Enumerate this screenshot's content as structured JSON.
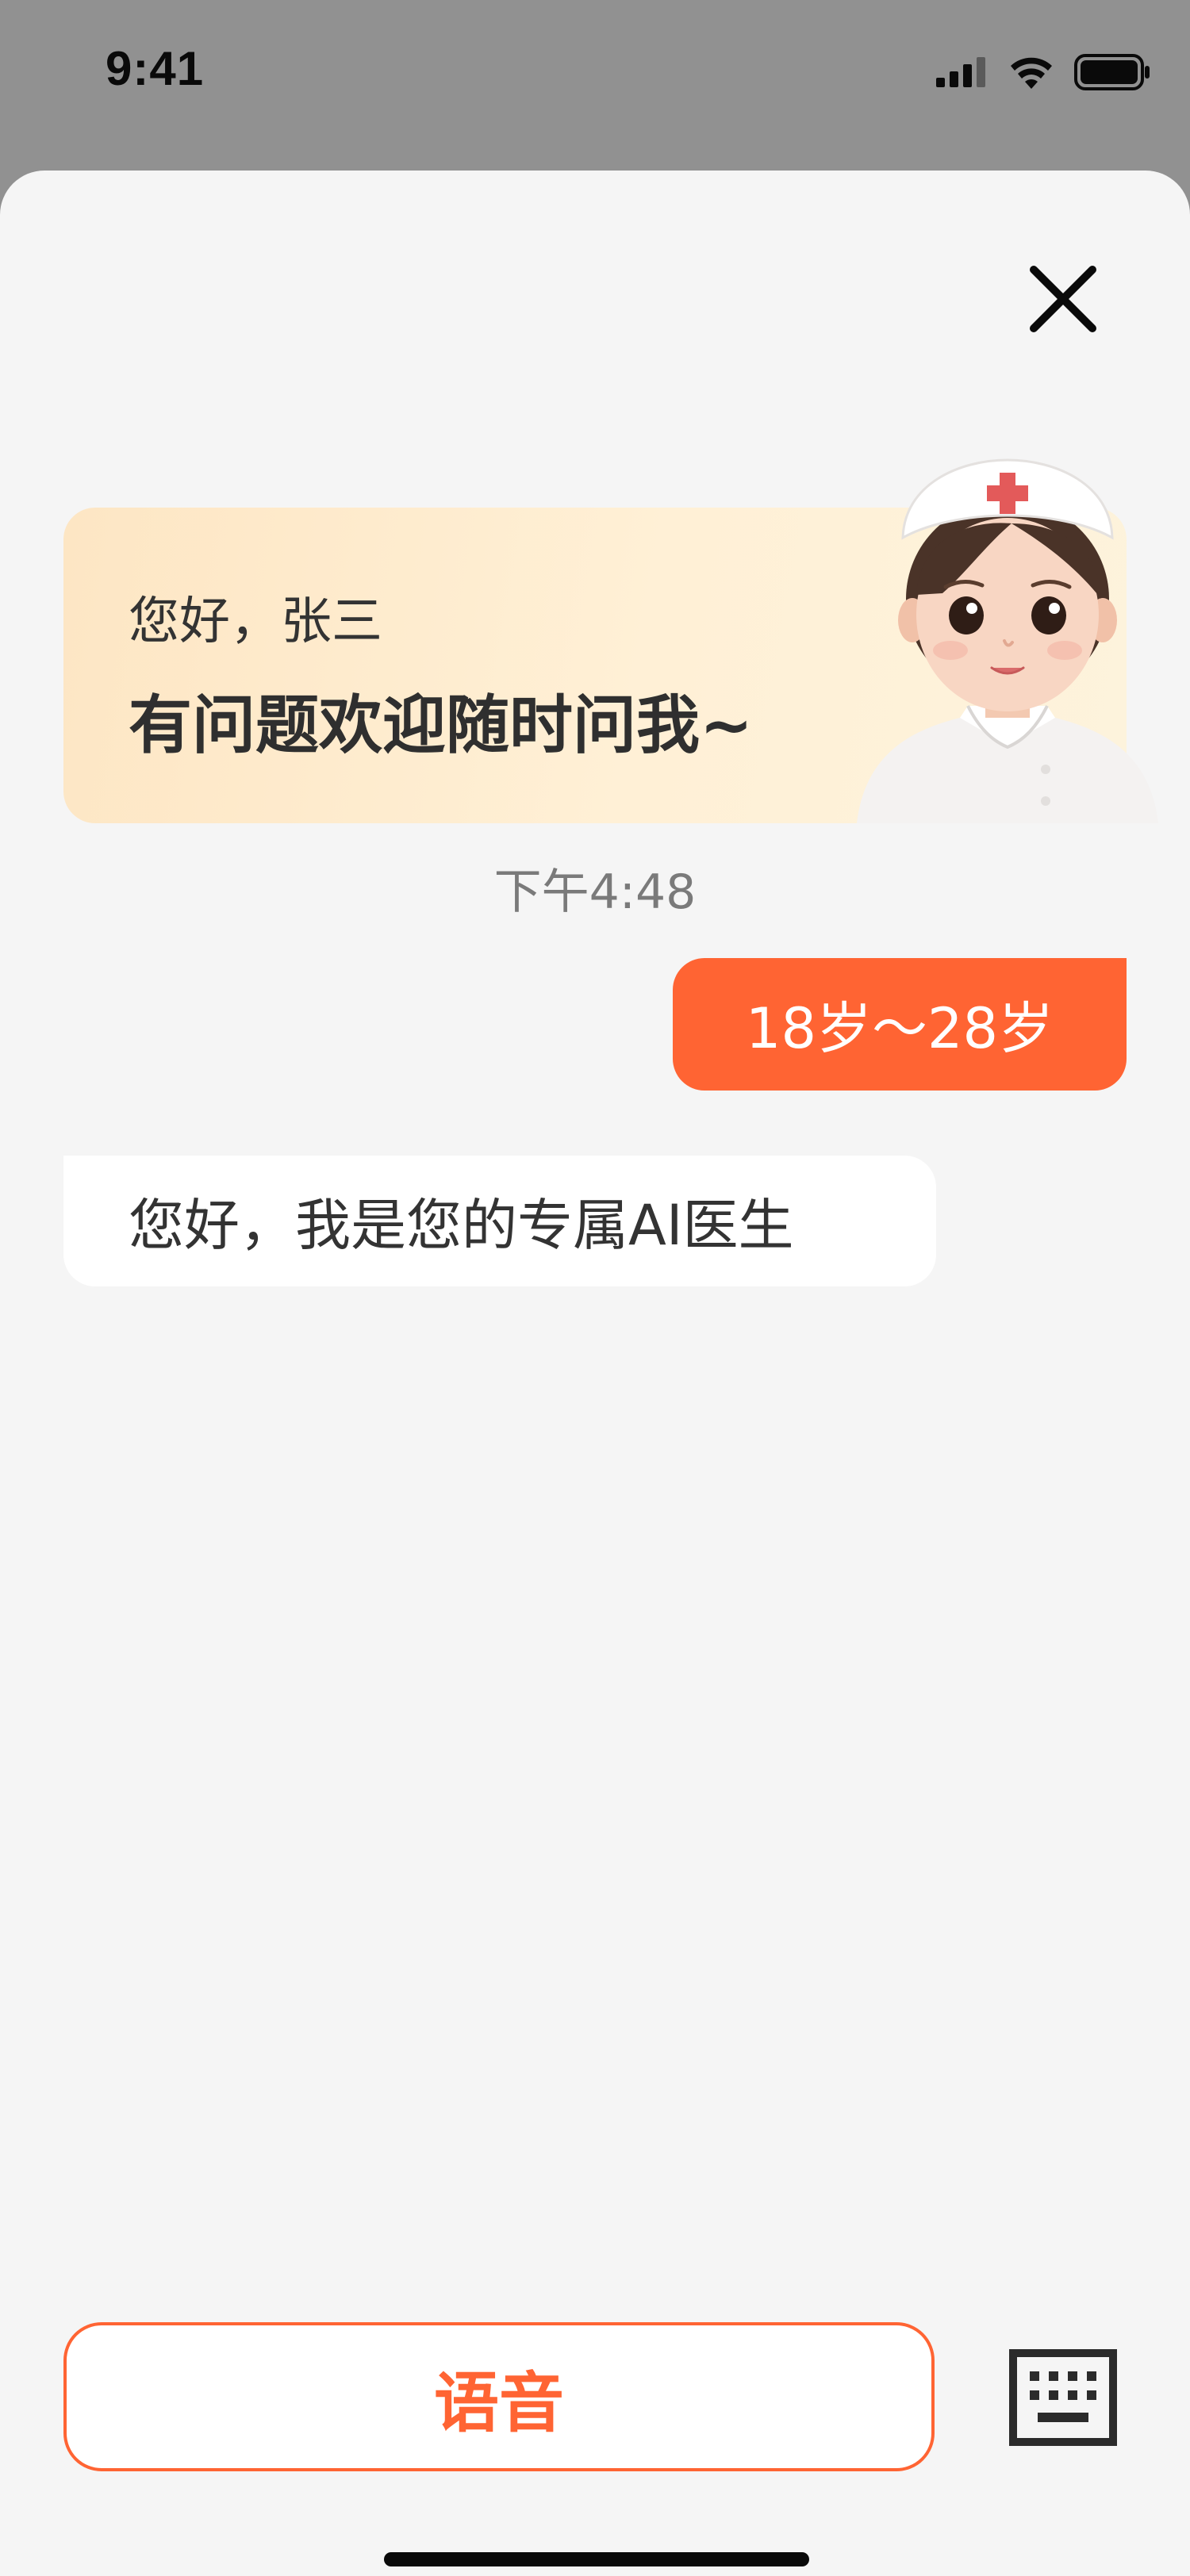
{
  "status_bar": {
    "time": "9:41",
    "icons": [
      "signal-icon",
      "wifi-icon",
      "battery-icon"
    ]
  },
  "header": {
    "close_icon": "close-icon"
  },
  "greeting": {
    "line1": "您好，张三",
    "line2": "有问题欢迎随时问我~",
    "avatar": "nurse-avatar"
  },
  "chat": {
    "timestamp": "下午4:48",
    "messages": [
      {
        "from": "user",
        "text": "18岁～28岁"
      },
      {
        "from": "assistant",
        "text": "您好，我是您的专属AI医生"
      }
    ]
  },
  "bottom_bar": {
    "voice_label": "语音",
    "keyboard_icon": "keyboard-icon"
  },
  "colors": {
    "accent": "#ff6433",
    "sheet_background": "#f5f5f5",
    "status_background": "#919191",
    "card_gradient_start": "#fde6c4",
    "card_gradient_end": "#fdf3dc"
  }
}
